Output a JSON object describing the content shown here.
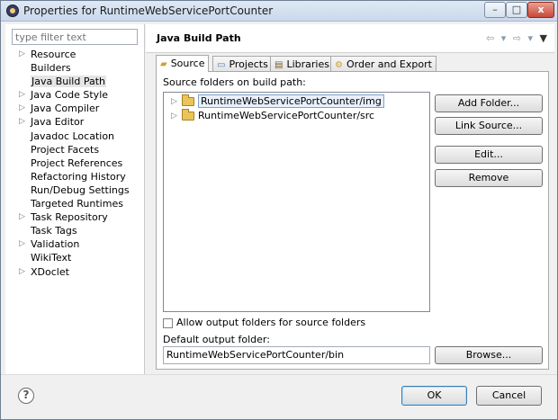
{
  "window": {
    "title": "Properties for RuntimeWebServicePortCounter",
    "min_glyph": "–",
    "max_glyph": "□",
    "close_glyph": "x"
  },
  "sidebar": {
    "filter_placeholder": "type filter text",
    "items": [
      {
        "label": "Resource",
        "expandable": true
      },
      {
        "label": "Builders",
        "expandable": false
      },
      {
        "label": "Java Build Path",
        "expandable": false,
        "selected": true
      },
      {
        "label": "Java Code Style",
        "expandable": true
      },
      {
        "label": "Java Compiler",
        "expandable": true
      },
      {
        "label": "Java Editor",
        "expandable": true
      },
      {
        "label": "Javadoc Location",
        "expandable": false
      },
      {
        "label": "Project Facets",
        "expandable": false
      },
      {
        "label": "Project References",
        "expandable": false
      },
      {
        "label": "Refactoring History",
        "expandable": false
      },
      {
        "label": "Run/Debug Settings",
        "expandable": false
      },
      {
        "label": "Targeted Runtimes",
        "expandable": false
      },
      {
        "label": "Task Repository",
        "expandable": true
      },
      {
        "label": "Task Tags",
        "expandable": false
      },
      {
        "label": "Validation",
        "expandable": true
      },
      {
        "label": "WikiText",
        "expandable": false
      },
      {
        "label": "XDoclet",
        "expandable": true
      }
    ]
  },
  "page": {
    "title": "Java Build Path",
    "nav_icons": [
      "back-arrow-icon",
      "forward-arrow-icon",
      "view-menu-icon"
    ]
  },
  "tabs": [
    {
      "label": "Source",
      "icon": "source-folder-icon",
      "active": true
    },
    {
      "label": "Projects",
      "icon": "projects-icon",
      "active": false
    },
    {
      "label": "Libraries",
      "icon": "libraries-icon",
      "active": false
    },
    {
      "label": "Order and Export",
      "icon": "order-export-icon",
      "active": false
    }
  ],
  "source": {
    "label": "Source folders on build path:",
    "folders": [
      {
        "label": "RuntimeWebServicePortCounter/img",
        "selected": true
      },
      {
        "label": "RuntimeWebServicePortCounter/src",
        "selected": false
      }
    ],
    "buttons": {
      "add_folder": "Add Folder...",
      "link_source": "Link Source...",
      "edit": "Edit...",
      "remove": "Remove",
      "browse": "Browse..."
    },
    "allow_output_label": "Allow output folders for source folders",
    "allow_output_checked": false,
    "default_output_label": "Default output folder:",
    "default_output_value": "RuntimeWebServicePortCounter/bin"
  },
  "footer": {
    "help_glyph": "?",
    "ok": "OK",
    "cancel": "Cancel"
  },
  "colors": {
    "window_bg": "#f0f0f0",
    "selection_border": "#7da2ce",
    "folder": "#e9c45a"
  }
}
